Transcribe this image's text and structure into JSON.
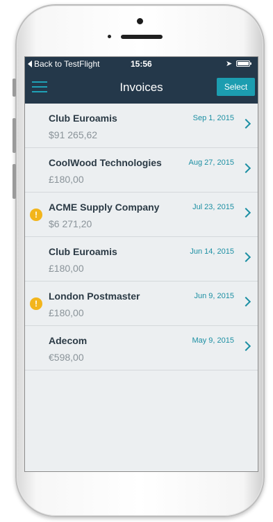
{
  "status_bar": {
    "back_label": "Back to TestFlight",
    "time": "15:56",
    "location_icon": "location-arrow-icon",
    "battery_icon": "battery-icon"
  },
  "nav_bar": {
    "title": "Invoices",
    "menu_icon": "hamburger-menu-icon",
    "select_label": "Select"
  },
  "invoices": [
    {
      "name": "Club Euroamis",
      "amount": "$91 265,62",
      "date": "Sep 1, 2015",
      "warning": false
    },
    {
      "name": "CoolWood Technologies",
      "amount": "£180,00",
      "date": "Aug 27, 2015",
      "warning": false
    },
    {
      "name": "ACME Supply Company",
      "amount": "$6 271,20",
      "date": "Jul 23, 2015",
      "warning": true
    },
    {
      "name": "Club Euroamis",
      "amount": "£180,00",
      "date": "Jun 14, 2015",
      "warning": false
    },
    {
      "name": "London Postmaster",
      "amount": "£180,00",
      "date": "Jun 9, 2015",
      "warning": true
    },
    {
      "name": "Adecom",
      "amount": "€598,00",
      "date": "May 9, 2015",
      "warning": false
    }
  ],
  "warning_glyph": "!",
  "colors": {
    "nav_background": "#24384a",
    "accent": "#1c9db0",
    "warning": "#f2b51c",
    "list_background": "#eceff1"
  }
}
